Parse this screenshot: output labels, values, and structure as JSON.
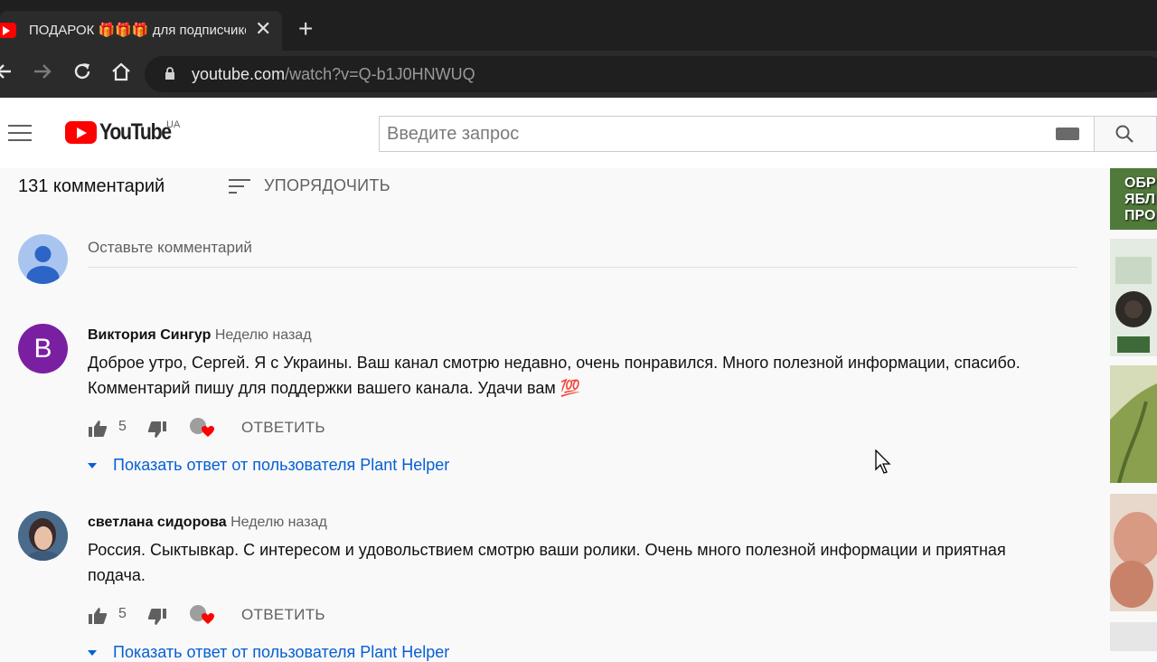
{
  "browser": {
    "tab_title": "ПОДАРОК 🎁🎁🎁 для подписчиков",
    "tab_close": "✕",
    "new_tab": "+",
    "url_host": "youtube.com",
    "url_path": "/watch?v=Q-b1J0HNWUQ"
  },
  "header": {
    "logo_text": "YouTube",
    "region": "UA",
    "search_placeholder": "Введите запрос"
  },
  "comments_section": {
    "count_label": "131 комментарий",
    "sort_label": "УПОРЯДОЧИТЬ",
    "add_comment_placeholder": "Оставьте комментарий"
  },
  "comments": [
    {
      "avatar_letter": "В",
      "author": "Виктория Сингур",
      "time": "Неделю назад",
      "text": "Доброе утро, Сергей. Я с  Украины. Ваш канал смотрю недавно, очень понравился. Много полезной информации, спасибо. Комментарий пишу для поддержки вашего канала. Удачи вам 💯",
      "likes": "5",
      "reply_label": "ОТВЕТИТЬ",
      "replies_label": "Показать ответ от пользователя Plant Helper"
    },
    {
      "author": "светлана сидорова",
      "time": "Неделю назад",
      "text": "Россия. Сыктывкар. С интересом и удовольствием смотрю ваши ролики. Очень много полезной информации и приятная подача.",
      "likes": "5",
      "reply_label": "ОТВЕТИТЬ",
      "replies_label": "Показать ответ от пользователя Plant Helper"
    }
  ],
  "sidebar": {
    "thumb1_text": "ОБР\nЯБЛ\nПРО"
  },
  "colors": {
    "brand_red": "#ff0000",
    "link_blue": "#065fd4",
    "avatar_purple": "#7b1fa2"
  },
  "icons": [
    "youtube-favicon-icon",
    "close-icon",
    "plus-icon",
    "back-icon",
    "forward-icon",
    "reload-icon",
    "home-icon",
    "lock-icon",
    "menu-icon",
    "keyboard-icon",
    "search-icon",
    "sort-icon",
    "thumbs-up-icon",
    "thumbs-down-icon",
    "creator-heart-icon",
    "caret-down-icon",
    "mouse-cursor-icon"
  ]
}
